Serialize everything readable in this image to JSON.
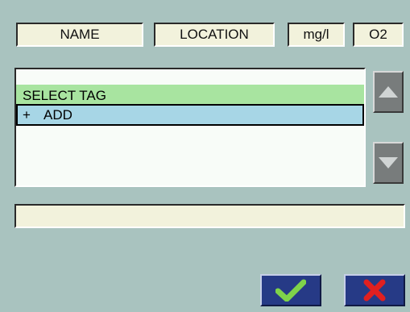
{
  "header": {
    "name_label": "NAME",
    "location_label": "LOCATION",
    "unit_label": "mg/l",
    "param_label": "O2"
  },
  "list": {
    "select_tag_label": "SELECT TAG",
    "add_prefix": "+",
    "add_label": "ADD"
  },
  "icons": {
    "scroll_up": "triangle-up",
    "scroll_down": "triangle-down",
    "confirm": "checkmark",
    "cancel": "x-cross"
  },
  "colors": {
    "background": "#a9c3bf",
    "select_row": "#a8e4a0",
    "add_row": "#a7d6e6",
    "action_button": "#263a86",
    "confirm_icon": "#7fd34a",
    "cancel_icon": "#e02020"
  },
  "status_text": ""
}
